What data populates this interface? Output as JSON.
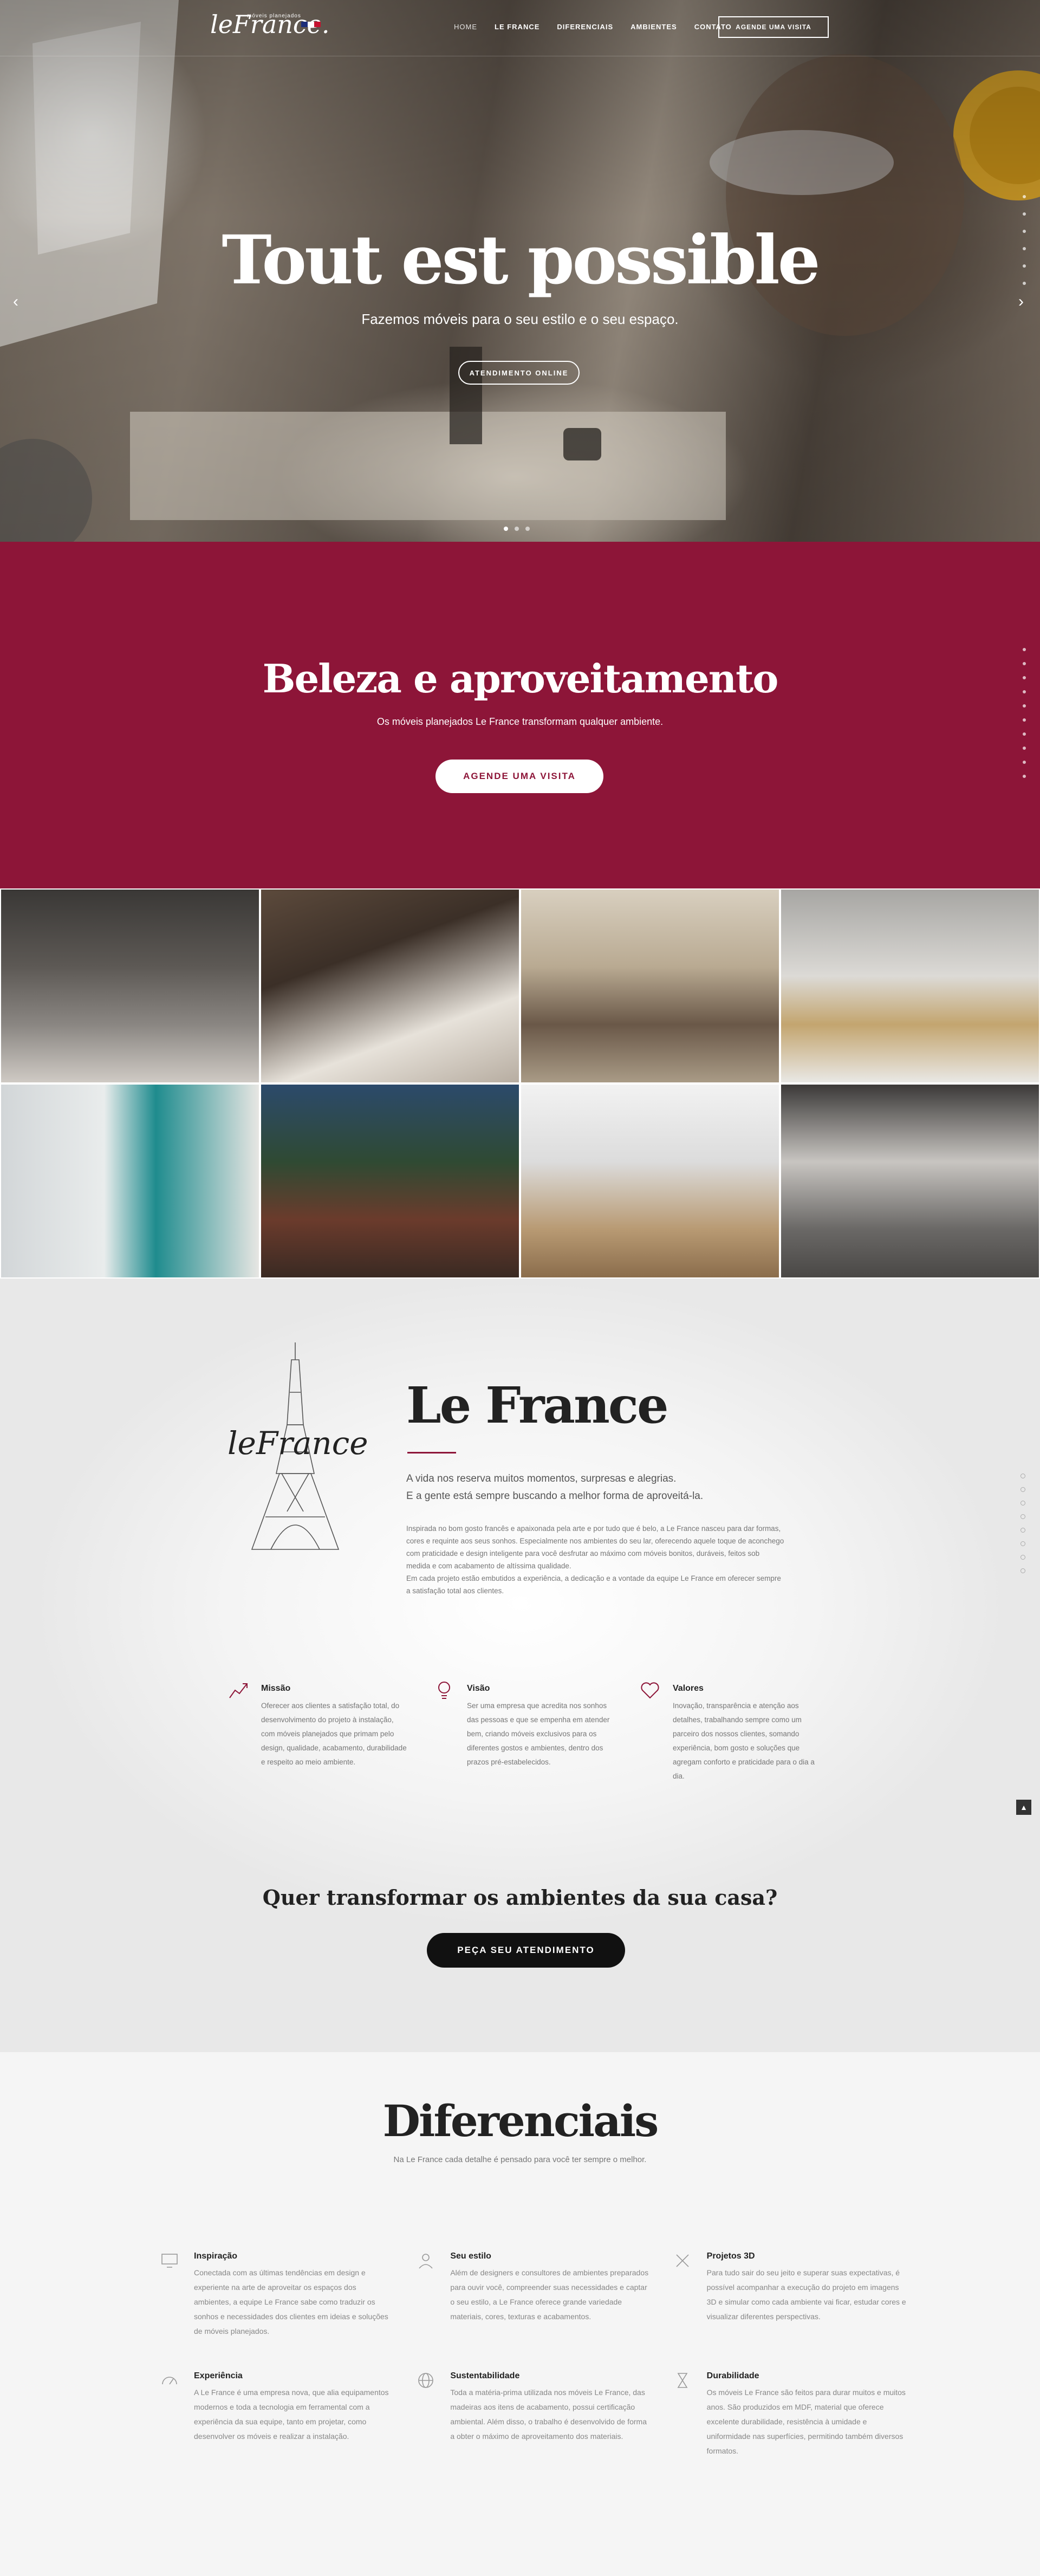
{
  "nav": {
    "logo": "leFrance.",
    "tagline": "móveis planejados",
    "links": [
      "HOME",
      "LE FRANCE",
      "DIFERENCIAIS",
      "AMBIENTES",
      "CONTATO"
    ],
    "cta": "AGENDE UMA VISITA"
  },
  "hero": {
    "title": "Tout est possible",
    "subtitle": "Fazemos móveis para o seu estilo e o seu espaço.",
    "button": "ATENDIMENTO ONLINE",
    "prev_icon": "‹",
    "next_icon": "›"
  },
  "beleza": {
    "title": "Beleza e aproveitamento",
    "subtitle": "Os móveis planejados Le France transformam qualquer ambiente.",
    "button": "AGENDE UMA VISITA"
  },
  "gallery": {
    "images": [
      "kitchen",
      "bedroom",
      "living-room",
      "bathroom",
      "kids-room",
      "terrace",
      "office",
      "closet"
    ]
  },
  "about": {
    "logo": "leFrance",
    "title": "Le France",
    "lead_1": "A vida nos reserva muitos momentos, surpresas e alegrias.",
    "lead_2": "E a gente está sempre buscando a melhor forma de aproveitá-la.",
    "body": "Inspirada no bom gosto francês e apaixonada pela arte e por tudo que é belo, a Le France nasceu para dar formas, cores e requinte aos seus sonhos. Especialmente nos ambientes do seu lar, oferecendo aquele toque de aconchego com praticidade e design inteligente para você desfrutar ao máximo com móveis bonitos, duráveis, feitos sob medida e com acabamento de altíssima qualidade.",
    "body_2": "Em cada projeto estão embutidos a experiência, a dedicação e a vontade da equipe Le France em oferecer sempre a satisfação total aos clientes.",
    "features": [
      {
        "title": "Missão",
        "text": "Oferecer aos clientes a satisfação total, do desenvolvimento do projeto à instalação, com móveis planejados que primam pelo design, qualidade, acabamento, durabilidade e respeito ao meio ambiente."
      },
      {
        "title": "Visão",
        "text": "Ser uma empresa que acredita nos sonhos das pessoas e que se empenha em atender bem, criando móveis exclusivos para os diferentes gostos e ambientes, dentro dos prazos pré-estabelecidos."
      },
      {
        "title": "Valores",
        "text": "Inovação, transparência e atenção aos detalhes, trabalhando sempre como um parceiro dos nossos clientes, somando experiência, bom gosto e soluções que agregam conforto e praticidade para o dia a dia."
      }
    ],
    "cta_title": "Quer transformar os ambientes da sua casa?",
    "cta_button": "PEÇA SEU ATENDIMENTO",
    "up_icon": "▲"
  },
  "diferenciais": {
    "title": "Diferenciais",
    "subtitle": "Na Le France cada detalhe é pensado para você ter sempre o melhor.",
    "items": [
      {
        "title": "Inspiração",
        "text": "Conectada com as últimas tendências em design e experiente na arte de aproveitar os espaços dos ambientes, a equipe Le France sabe como traduzir os sonhos e necessidades dos clientes em ideias e soluções de móveis planejados."
      },
      {
        "title": "Seu estilo",
        "text": "Além de designers e consultores de ambientes preparados para ouvir você, compreender suas necessidades e captar o seu estilo, a Le France oferece grande variedade materiais, cores, texturas e acabamentos."
      },
      {
        "title": "Projetos 3D",
        "text": "Para tudo sair do seu jeito e superar suas expectativas, é possível acompanhar a execução do projeto em imagens 3D e simular como cada ambiente vai ficar, estudar cores e visualizar diferentes perspectivas."
      },
      {
        "title": "Experiência",
        "text": "A Le France é uma empresa nova, que alia equipamentos modernos e toda a tecnologia em ferramental com a experiência da sua equipe, tanto em projetar, como desenvolver os móveis e realizar a instalação."
      },
      {
        "title": "Sustentabilidade",
        "text": "Toda a matéria-prima utilizada nos móveis Le France, das madeiras aos itens de acabamento, possui certificação ambiental. Além disso, o trabalho é desenvolvido de forma a obter o máximo de aproveitamento dos materiais."
      },
      {
        "title": "Durabilidade",
        "text": "Os móveis Le France são feitos para durar muitos e muitos anos. São produzidos em MDF, material que oferece excelente durabilidade, resistência à umidade e uniformidade nas superfícies, permitindo também diversos formatos."
      }
    ]
  },
  "colors": {
    "brand": "#8d1538",
    "dark": "#111111"
  }
}
